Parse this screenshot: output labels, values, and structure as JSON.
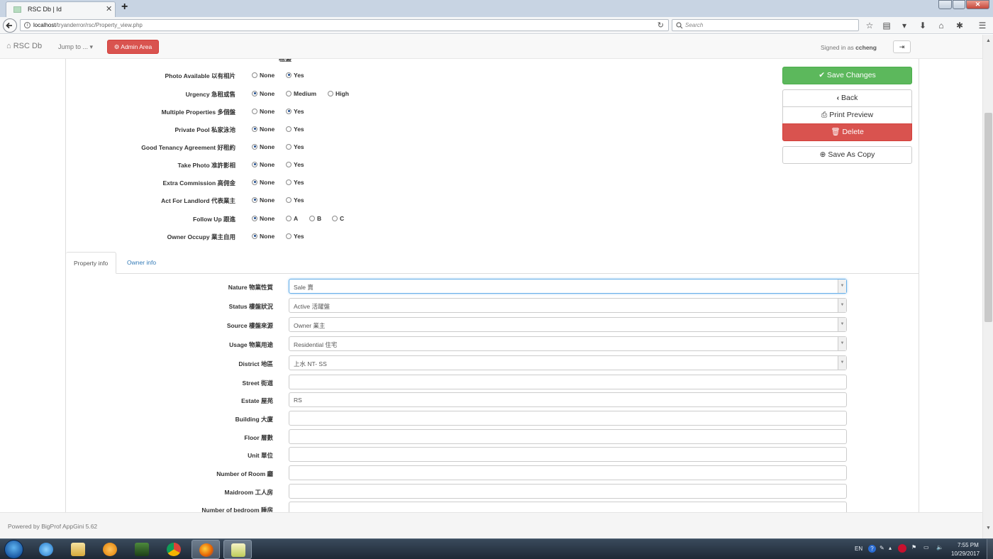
{
  "browser": {
    "tab_title": "RSC Db | Id",
    "url_host": "localhost",
    "url_path": "/tryanderror/rsc/Property_view.php",
    "search_placeholder": "Search"
  },
  "app_nav": {
    "brand": "RSC Db",
    "jump_to": "Jump to ...",
    "admin_area": "Admin Area",
    "signed_in_prefix": "Signed in as",
    "username": "ccheng"
  },
  "flags": {
    "partial_top_label": "租盤",
    "rows": [
      {
        "label": "Photo Available 以有相片",
        "options": [
          {
            "text": "None",
            "checked": false
          },
          {
            "text": "Yes",
            "checked": true
          }
        ]
      },
      {
        "label": "Urgency 急租或售",
        "options": [
          {
            "text": "None",
            "checked": true
          },
          {
            "text": "Medium",
            "checked": false
          },
          {
            "text": "High",
            "checked": false
          }
        ]
      },
      {
        "label": "Multiple Properties 多個盤",
        "options": [
          {
            "text": "None",
            "checked": false
          },
          {
            "text": "Yes",
            "checked": true
          }
        ]
      },
      {
        "label": "Private Pool 私家泳池",
        "options": [
          {
            "text": "None",
            "checked": true
          },
          {
            "text": "Yes",
            "checked": false
          }
        ]
      },
      {
        "label": "Good Tenancy Agreement 好租約",
        "options": [
          {
            "text": "None",
            "checked": true
          },
          {
            "text": "Yes",
            "checked": false
          }
        ]
      },
      {
        "label": "Take Photo 准許影相",
        "options": [
          {
            "text": "None",
            "checked": true
          },
          {
            "text": "Yes",
            "checked": false
          }
        ]
      },
      {
        "label": "Extra Commission 高佣金",
        "options": [
          {
            "text": "None",
            "checked": true
          },
          {
            "text": "Yes",
            "checked": false
          }
        ]
      },
      {
        "label": "Act For Landlord 代表業主",
        "options": [
          {
            "text": "None",
            "checked": true
          },
          {
            "text": "Yes",
            "checked": false
          }
        ]
      },
      {
        "label": "Follow Up 跟進",
        "options": [
          {
            "text": "None",
            "checked": true
          },
          {
            "text": "A",
            "checked": false
          },
          {
            "text": "B",
            "checked": false
          },
          {
            "text": "C",
            "checked": false
          }
        ]
      },
      {
        "label": "Owner Occupy 業主自用",
        "options": [
          {
            "text": "None",
            "checked": true
          },
          {
            "text": "Yes",
            "checked": false
          }
        ]
      }
    ]
  },
  "actions": {
    "save": "Save Changes",
    "back": "Back",
    "print": "Print Preview",
    "delete": "Delete",
    "save_copy": "Save As Copy"
  },
  "tabs": {
    "property_info": "Property info",
    "owner_info": "Owner info"
  },
  "fields": [
    {
      "label": "Nature 物業性質",
      "value": "Sale 賣",
      "type": "select"
    },
    {
      "label": "Status 樓盤狀況",
      "value": "Active 活躍盤",
      "type": "select"
    },
    {
      "label": "Source 樓盤來源",
      "value": "Owner 業主",
      "type": "select"
    },
    {
      "label": "Usage 物業用途",
      "value": "Residential 住宅",
      "type": "select"
    },
    {
      "label": "District 地區",
      "value": "上水 NT- SS",
      "type": "select"
    },
    {
      "label": "Street 街道",
      "value": "",
      "type": "text"
    },
    {
      "label": "Estate 屋苑",
      "value": "RS",
      "type": "text"
    },
    {
      "label": "Building 大廈",
      "value": "",
      "type": "text"
    },
    {
      "label": "Floor 層數",
      "value": "",
      "type": "text"
    },
    {
      "label": "Unit 單位",
      "value": "",
      "type": "text"
    },
    {
      "label": "Number of Room 廳",
      "value": "",
      "type": "text"
    },
    {
      "label": "Maidroom 工人房",
      "value": "",
      "type": "text"
    },
    {
      "label": "Number of bedroom 睡房",
      "value": "",
      "type": "text"
    }
  ],
  "footer": {
    "powered_by": "Powered by BigProf AppGini 5.62"
  },
  "taskbar": {
    "lang": "EN",
    "time": "7:55 PM",
    "date": "10/29/2017"
  }
}
